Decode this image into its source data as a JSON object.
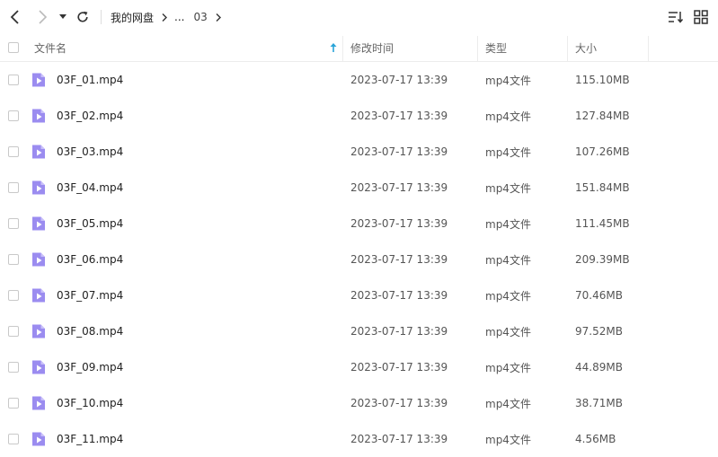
{
  "toolbar": {
    "breadcrumb": {
      "root": "我的网盘",
      "ellipsis": "...",
      "current": "03"
    },
    "icons": [
      "back-icon",
      "forward-icon",
      "dropdown-icon",
      "refresh-icon",
      "sort-list-icon",
      "grid-view-icon"
    ]
  },
  "table": {
    "columns": {
      "name": "文件名",
      "modified": "修改时间",
      "type": "类型",
      "size": "大小"
    },
    "sort": {
      "column": "name",
      "direction": "ascending"
    },
    "rows": [
      {
        "name": "03F_01.mp4",
        "modified": "2023-07-17 13:39",
        "type": "mp4文件",
        "size": "115.10MB"
      },
      {
        "name": "03F_02.mp4",
        "modified": "2023-07-17 13:39",
        "type": "mp4文件",
        "size": "127.84MB"
      },
      {
        "name": "03F_03.mp4",
        "modified": "2023-07-17 13:39",
        "type": "mp4文件",
        "size": "107.26MB"
      },
      {
        "name": "03F_04.mp4",
        "modified": "2023-07-17 13:39",
        "type": "mp4文件",
        "size": "151.84MB"
      },
      {
        "name": "03F_05.mp4",
        "modified": "2023-07-17 13:39",
        "type": "mp4文件",
        "size": "111.45MB"
      },
      {
        "name": "03F_06.mp4",
        "modified": "2023-07-17 13:39",
        "type": "mp4文件",
        "size": "209.39MB"
      },
      {
        "name": "03F_07.mp4",
        "modified": "2023-07-17 13:39",
        "type": "mp4文件",
        "size": "70.46MB"
      },
      {
        "name": "03F_08.mp4",
        "modified": "2023-07-17 13:39",
        "type": "mp4文件",
        "size": "97.52MB"
      },
      {
        "name": "03F_09.mp4",
        "modified": "2023-07-17 13:39",
        "type": "mp4文件",
        "size": "44.89MB"
      },
      {
        "name": "03F_10.mp4",
        "modified": "2023-07-17 13:39",
        "type": "mp4文件",
        "size": "38.71MB"
      },
      {
        "name": "03F_11.mp4",
        "modified": "2023-07-17 13:39",
        "type": "mp4文件",
        "size": "4.56MB"
      }
    ]
  },
  "colors": {
    "video_icon": "#9b8cf0",
    "sort_arrow": "#2aa4d8"
  }
}
